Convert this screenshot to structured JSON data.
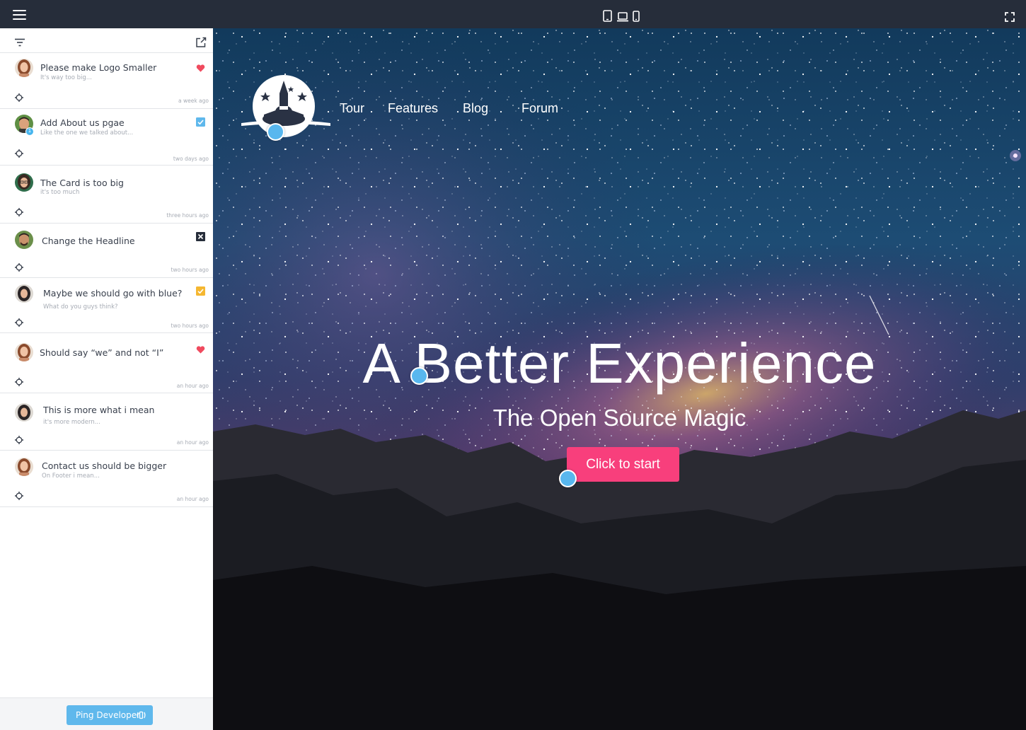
{
  "app": {
    "device_icons": [
      "tablet-icon",
      "laptop-icon",
      "phone-icon"
    ]
  },
  "sidebar": {
    "comments": [
      {
        "title": "Please make Logo Smaller",
        "subtitle": "It's way too big...",
        "time": "a week ago",
        "status": "heart"
      },
      {
        "title": "Add About us pgae",
        "subtitle": "Like the one we talked about...",
        "time": "two days ago",
        "status": "checked-blue",
        "badge": "1"
      },
      {
        "title": "The Card is too big",
        "subtitle": "it's too much",
        "time": "three hours ago",
        "status": "none"
      },
      {
        "title": "Change the Headline",
        "subtitle": "",
        "time": "two hours ago",
        "status": "x-box"
      },
      {
        "title": "Maybe we should go with blue?",
        "subtitle": "What do you guys think?",
        "time": "two hours ago",
        "status": "checked-yellow"
      },
      {
        "title": "Should say “we” and not “I”",
        "subtitle": "",
        "time": "an hour ago",
        "status": "heart"
      },
      {
        "title": "This is more what i mean",
        "subtitle": "it's more modern...",
        "time": "an hour ago",
        "status": "none"
      },
      {
        "title": "Contact us should be bigger",
        "subtitle": "On Footer i mean...",
        "time": "an hour ago",
        "status": "none"
      }
    ],
    "ping_label": "Ping Developer"
  },
  "preview": {
    "nav": [
      "Tour",
      "Features",
      "Blog",
      "Forum"
    ],
    "hero_title": "A Better Experience",
    "hero_subtitle": "The Open Source Magic",
    "cta_label": "Click to start"
  },
  "colors": {
    "topbar": "#262d3a",
    "accent_blue": "#58b7ee",
    "cta_pink": "#f83f7c",
    "heart_red": "#f04a5e",
    "check_yellow": "#f5b731"
  }
}
